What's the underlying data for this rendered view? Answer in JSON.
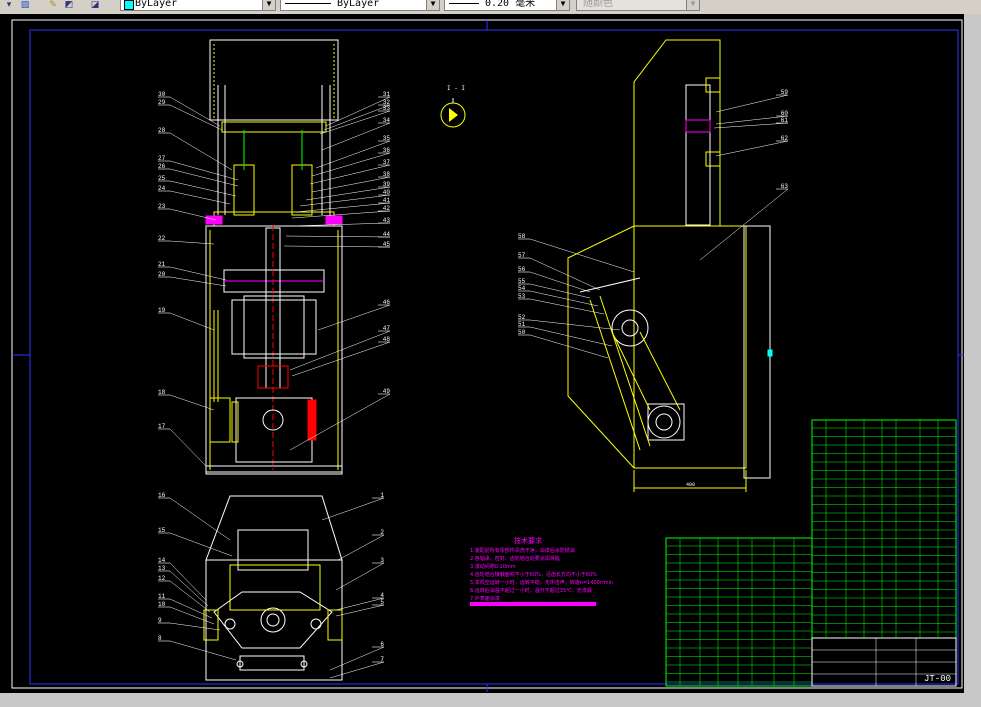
{
  "toolbar": {
    "layer_combo": "ByLayer",
    "linetype_combo": "ByLayer",
    "lineweight_combo": "0.20 毫米",
    "plotstyle_combo": "随颜色"
  },
  "drawing": {
    "title_block": {
      "drawing_number": "JT-00"
    },
    "tech_req": {
      "heading": "技术要求",
      "lines": [
        "1.装配前所有零部件清洗干净，油漆后涂防锈油",
        "2.各轴承、密封、齿轮啮合处要涂润滑脂",
        "3.滚动间隙0.10mm",
        "4.齿轮啮合接触面积不小于60%，沿齿长方向不小于60%",
        "5.本机空运转一小时，运转平稳，无冲击声，转速n=1400r/min",
        "6.运转后油温不超过一小时，温升不超过35℃，无渗漏",
        "7.外表面涂漆"
      ]
    },
    "labels_left": [
      "30",
      "29",
      "28",
      "27",
      "26",
      "25",
      "24",
      "23",
      "22",
      "21",
      "20",
      "19",
      "18",
      "17"
    ],
    "labels_right": [
      "31",
      "32",
      "33",
      "34",
      "35",
      "36",
      "37",
      "38",
      "39",
      "40",
      "41",
      "42",
      "43",
      "44",
      "45",
      "46",
      "47",
      "48",
      "49"
    ],
    "labels_bottom_left": [
      "16",
      "15",
      "14",
      "13",
      "12",
      "11",
      "10",
      "9",
      "8"
    ],
    "labels_bottom_right": [
      "1",
      "2",
      "3",
      "4",
      "5",
      "6",
      "7"
    ],
    "labels_side_left": [
      "58",
      "57",
      "56",
      "55",
      "54",
      "53",
      "52",
      "51",
      "50"
    ],
    "labels_side_right": [
      "59",
      "60",
      "61",
      "62",
      "63"
    ],
    "section_mark": "I - I",
    "dimension_text": "400"
  }
}
